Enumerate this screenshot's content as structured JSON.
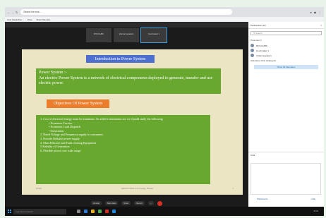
{
  "browser": {
    "address": "Search the web...",
    "nav_icons": [
      "back-icon",
      "forward-icon",
      "refresh-icon",
      "home-icon"
    ],
    "right_icons": [
      "profile-icon",
      "extensions-icon",
      "menu-icon"
    ]
  },
  "bookmarks": [
    "Guru Nanak Dev...",
    "Drive",
    "Show Video Ed..."
  ],
  "tiles": [
    "RIYA HUBC",
    "Internal speakers",
    "Courtmaker 1"
  ],
  "slide": {
    "title": "Introduction to Power System",
    "def_head": "Power System :-",
    "def_body": "An electric Power System is a network of electrical components deployed to generate, transfer and use electric power.",
    "objectives": "Objectives Of Power System",
    "items": [
      {
        "text": "1.  Cost of electrical energy must be minimum. To achieve minimum cost we should study the following",
        "sub": false
      },
      {
        "text": "•  Economic Factors.",
        "sub": true
      },
      {
        "text": "•  Economic Load Dispatch",
        "sub": true
      },
      {
        "text": "•  Generation",
        "sub": true
      },
      {
        "text": "2.  Rated Voltage and Frequency supply to consumers.",
        "sub": false
      },
      {
        "text": "3. Provide Reliable power supply",
        "sub": false
      },
      {
        "text": "4. Most Efficient and Fault clearing Equipment",
        "sub": false
      },
      {
        "text": "5.Stability of Generation",
        "sub": false
      },
      {
        "text": "6. Flexible  power over wide range",
        "sub": false
      }
    ],
    "footer_left": "20/4/21",
    "footer_mid": "National Institute of Technology, Srinagar",
    "footer_right": "1"
  },
  "panel": {
    "title": "Participants (11)",
    "search": "Search",
    "presenter": "Presenter 3",
    "people": [
      "RIYA HUBC",
      "Courtmaker 1",
      "Invited speakers"
    ],
    "attendees": "Attendees 10 (0 displayed)",
    "show_btn": "Show All Attendees",
    "chat": "Chat",
    "participants_btn": "Participants",
    "chat_btn": "Chat"
  },
  "controls": [
    "Unmute",
    "Start video",
    "Share",
    "Record"
  ],
  "taskbar": {
    "search": "Type here to search",
    "time": "12:41"
  }
}
